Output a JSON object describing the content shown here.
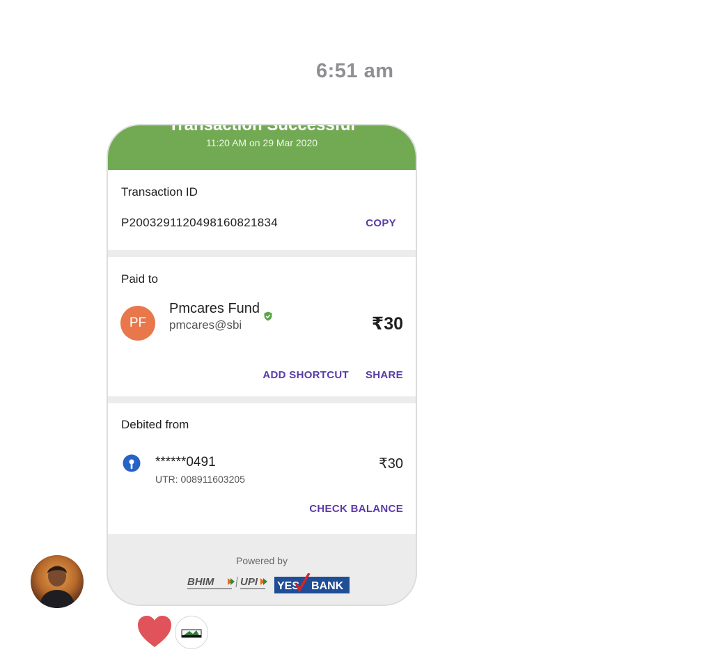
{
  "timestamp": "6:51 am",
  "receipt": {
    "header_title": "Transaction Successful",
    "header_subtitle": "11:20 AM on 29 Mar 2020",
    "transaction": {
      "label": "Transaction ID",
      "id": "P2003291120498160821834",
      "copy_label": "COPY"
    },
    "paid_to": {
      "label": "Paid to",
      "avatar_initials": "PF",
      "name": "Pmcares Fund",
      "vpa": "pmcares@sbi",
      "amount": "₹30",
      "add_shortcut_label": "ADD SHORTCUT",
      "share_label": "SHARE",
      "verified_icon": "verified-shield-icon"
    },
    "debited_from": {
      "label": "Debited from",
      "account": "******0491",
      "utr": "UTR: 008911603205",
      "amount": "₹30",
      "check_balance_label": "CHECK BALANCE",
      "bank_icon": "sbi-bank-icon"
    },
    "footer": {
      "powered_by": "Powered by",
      "bhim_text": "BHIM",
      "upi_text": "UPI",
      "yes_text": "YES",
      "bank_text": "BANK"
    }
  },
  "colors": {
    "header_green": "#71aa52",
    "accent_purple": "#5b3aa8",
    "avatar_orange": "#e8774b",
    "heart_red": "#e0535a",
    "yes_bank_blue": "#1f4e96",
    "timestamp_gray": "#8e8e93"
  },
  "reactions": {
    "heart_icon": "heart-icon",
    "badge_icon": "sticker-badge-icon"
  }
}
